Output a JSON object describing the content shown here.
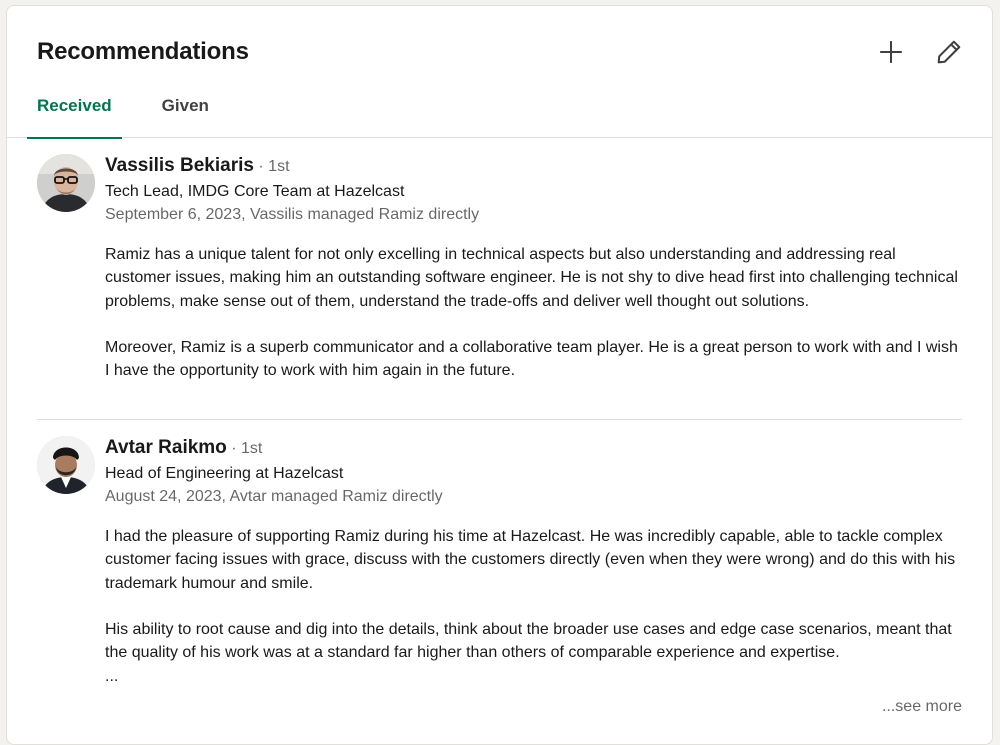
{
  "header": {
    "title": "Recommendations",
    "add_icon": "plus-icon",
    "edit_icon": "pencil-icon"
  },
  "tabs": [
    {
      "label": "Received",
      "active": true
    },
    {
      "label": "Given",
      "active": false
    }
  ],
  "accent_color": "#01754f",
  "recommendations": [
    {
      "name": "Vassilis Bekiaris",
      "degree": " · 1st",
      "headline": "Tech Lead, IMDG Core Team at Hazelcast",
      "meta": "September 6, 2023, Vassilis managed Ramiz directly",
      "text": "Ramiz has a unique talent for not only excelling in technical aspects but also understanding and addressing real customer issues, making him an outstanding software engineer. He is not shy to dive head first into challenging technical problems, make sense out of them, understand the trade-offs and deliver well thought out solutions.\n\nMoreover, Ramiz is a superb communicator and a collaborative team player. He is a great person to work with and I wish I have the opportunity to work with him again in the future."
    },
    {
      "name": "Avtar Raikmo",
      "degree": " · 1st",
      "headline": "Head of Engineering at Hazelcast",
      "meta": "August 24, 2023, Avtar managed Ramiz directly",
      "text": "I had the pleasure of supporting Ramiz during his time at Hazelcast. He was incredibly capable, able to tackle complex customer facing issues with grace, discuss with the customers directly (even when they were wrong) and do this with his trademark humour and smile.\n\nHis ability to root cause and dig into the details, think about the broader use cases and edge case scenarios, meant that the quality of his work was at a standard far higher than others of comparable experience and expertise.\n...",
      "see_more": "...see more"
    }
  ]
}
